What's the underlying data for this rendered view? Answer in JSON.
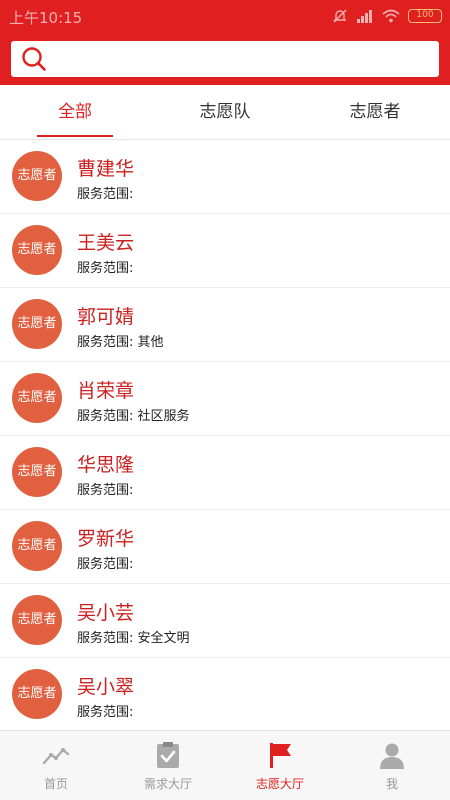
{
  "status_bar": {
    "time": "上午10:15",
    "battery": "100"
  },
  "search": {
    "placeholder": "",
    "value": ""
  },
  "tabs": [
    {
      "label": "全部",
      "active": true
    },
    {
      "label": "志愿队",
      "active": false
    },
    {
      "label": "志愿者",
      "active": false
    }
  ],
  "volunteers": [
    {
      "badge": "志愿者",
      "name": "曹建华",
      "scope": "服务范围:"
    },
    {
      "badge": "志愿者",
      "name": "王美云",
      "scope": "服务范围:"
    },
    {
      "badge": "志愿者",
      "name": "郭可婧",
      "scope": "服务范围: 其他"
    },
    {
      "badge": "志愿者",
      "name": "肖荣章",
      "scope": "服务范围: 社区服务"
    },
    {
      "badge": "志愿者",
      "name": "华思隆",
      "scope": "服务范围:"
    },
    {
      "badge": "志愿者",
      "name": "罗新华",
      "scope": "服务范围:"
    },
    {
      "badge": "志愿者",
      "name": "吴小芸",
      "scope": "服务范围: 安全文明"
    },
    {
      "badge": "志愿者",
      "name": "吴小翠",
      "scope": "服务范围:"
    }
  ],
  "bottom_nav": [
    {
      "label": "首页",
      "icon": "trend-chart-icon",
      "active": false
    },
    {
      "label": "需求大厅",
      "icon": "clipboard-check-icon",
      "active": false
    },
    {
      "label": "志愿大厅",
      "icon": "flag-icon",
      "active": true
    },
    {
      "label": "我",
      "icon": "user-icon",
      "active": false
    }
  ],
  "colors": {
    "brand": "#e02020",
    "avatar": "#e06040",
    "name": "#cc2020",
    "inactive": "#999999"
  }
}
